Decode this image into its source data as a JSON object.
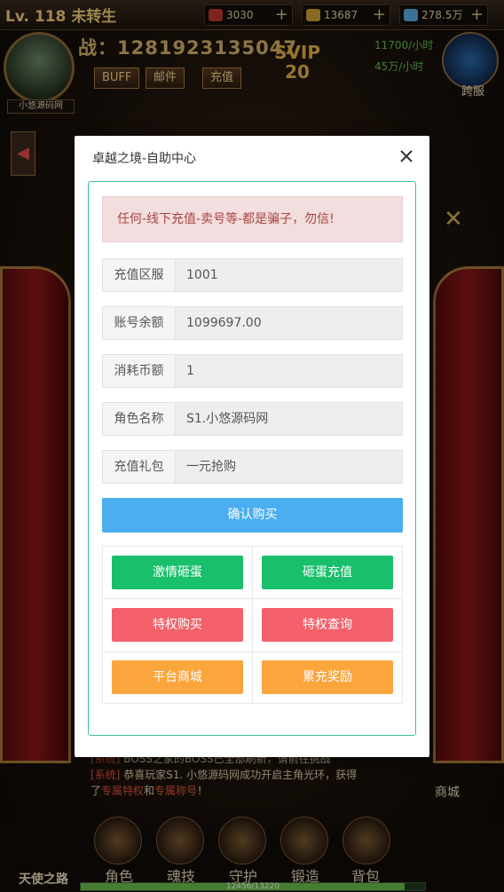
{
  "game": {
    "level_text": "Lv. 118",
    "rebirth_text": "未转生",
    "resources": [
      {
        "name": "ruby",
        "value": "3030",
        "color": "#c0392b"
      },
      {
        "name": "gold",
        "value": "13687",
        "color": "#d4a23a"
      },
      {
        "name": "diamond",
        "value": "278.5万",
        "color": "#5ab0e8"
      }
    ],
    "power_text": "战：1281923135047",
    "avatar_name": "小悠源码网",
    "buttons": [
      "BUFF",
      "邮件",
      "充值"
    ],
    "svip": {
      "label": "SVIP",
      "level": "20"
    },
    "rates": [
      "11700/小时",
      "45万/小时"
    ],
    "cross_server_label": "跨服",
    "chat": {
      "line1_tag": "[系统]",
      "line1_text": "BOSS之家的BOSS已全部刷新，请前往挑战",
      "line2_tag": "[系统]",
      "line2_text": "恭喜玩家S1. 小悠源码网成功开启主角光环，获得",
      "line3_pre": "了",
      "line3_red1": "专属特权",
      "line3_mid": "和",
      "line3_red2": "专属称号",
      "line3_end": "！"
    },
    "shop_label": "商城",
    "bottom_menu": [
      "角色",
      "魂技",
      "守护",
      "锻造",
      "背包"
    ],
    "exp": {
      "text": "12456/13220",
      "fraction": 0.94
    },
    "logo_text": "天使之路"
  },
  "modal": {
    "title": "卓越之境-自助中心",
    "alert": "任何-线下充值-卖号等-都是骗子，勿信!",
    "fields": [
      {
        "label": "充值区服",
        "value": "1001"
      },
      {
        "label": "账号余额",
        "value": "1099697.00"
      },
      {
        "label": "消耗币额",
        "value": "1"
      },
      {
        "label": "角色名称",
        "value": "S1.小悠源码网"
      },
      {
        "label": "充值礼包",
        "value": "一元抢购"
      }
    ],
    "confirm_label": "确认购买",
    "grid_buttons": [
      {
        "label": "激情砸蛋",
        "color": "#19bf6b"
      },
      {
        "label": "砸蛋充值",
        "color": "#19bf6b"
      },
      {
        "label": "特权购买",
        "color": "#f4616a"
      },
      {
        "label": "特权查询",
        "color": "#f4616a"
      },
      {
        "label": "平台商城",
        "color": "#fba53d"
      },
      {
        "label": "累充奖励",
        "color": "#fba53d"
      }
    ]
  }
}
